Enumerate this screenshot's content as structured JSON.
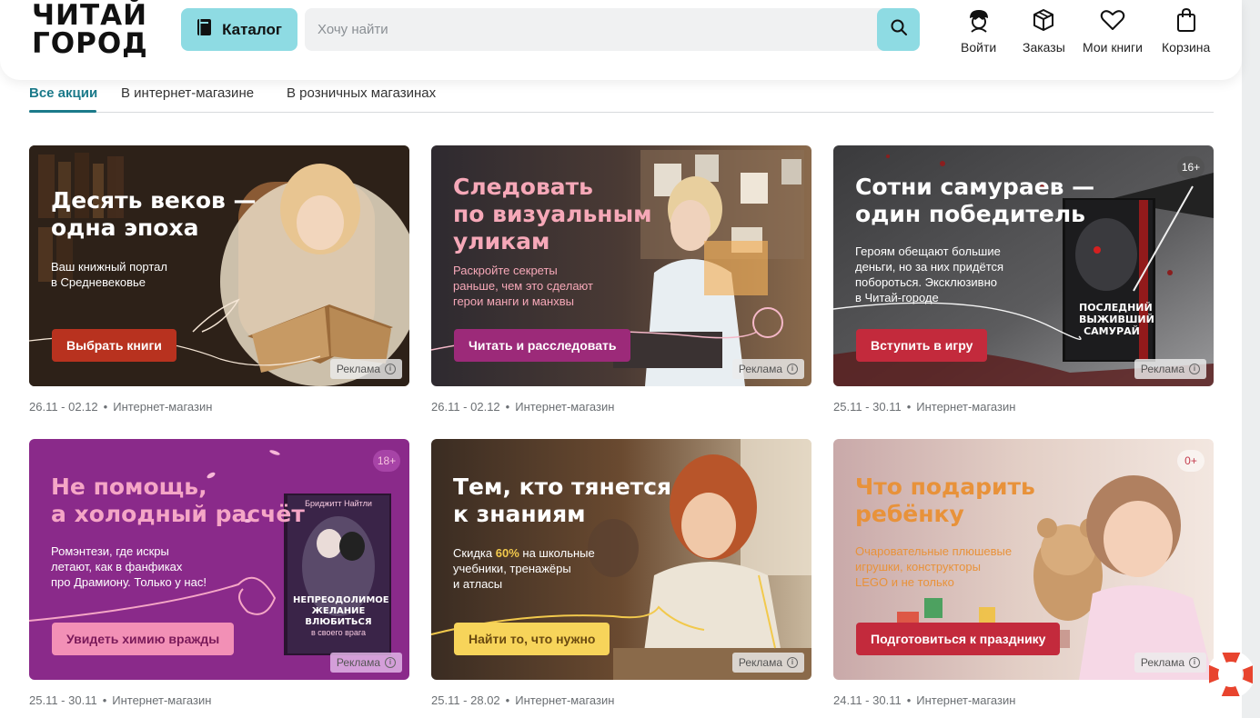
{
  "header": {
    "logo_line1": "ЧИТАЙ",
    "logo_line2": "ГОРОД",
    "catalog_label": "Каталог",
    "search_placeholder": "Хочу найти",
    "nav": [
      {
        "label": "Войти",
        "icon": "user-icon"
      },
      {
        "label": "Заказы",
        "icon": "box-icon"
      },
      {
        "label": "Мои книги",
        "icon": "heart-icon"
      },
      {
        "label": "Корзина",
        "icon": "bag-icon"
      }
    ]
  },
  "tabs": [
    {
      "label": "Все акции",
      "active": true
    },
    {
      "label": "В интернет-магазине",
      "active": false
    },
    {
      "label": "В розничных магазинах",
      "active": false
    }
  ],
  "colors": {
    "accent": "#8edbe3",
    "active_tab": "#1b7a8a"
  },
  "cards": [
    {
      "title_line1": "Десять веков —",
      "title_line2": "одна эпоха",
      "title_line3": "",
      "sub_line1": "Ваш книжный портал",
      "sub_line2": "в Средневековье",
      "sub_line3": "",
      "sub_line4": "",
      "cta": "Выбрать книги",
      "ad": "Реклама",
      "age": "",
      "dates": "26.11 - 02.12",
      "channel": "Интернет-магазин"
    },
    {
      "title_line1": "Следовать",
      "title_line2": "по визуальным",
      "title_line3": "уликам",
      "sub_line1": "Раскройте секреты",
      "sub_line2": "раньше, чем это сделают",
      "sub_line3": "герои манги и манхвы",
      "sub_line4": "",
      "cta": "Читать и расследовать",
      "ad": "Реклама",
      "age": "",
      "dates": "26.11 - 02.12",
      "channel": "Интернет-магазин"
    },
    {
      "title_line1": "Сотни самураев —",
      "title_line2": "один победитель",
      "title_line3": "",
      "sub_line1": "Героям обещают большие",
      "sub_line2": "деньги, но за них придётся",
      "sub_line3": "побороться. Эксклюзивно",
      "sub_line4": "в Читай-городе",
      "cta": "Вступить в игру",
      "ad": "Реклама",
      "age": "16+",
      "book_title": "ПОСЛЕДНИЙ ВЫЖИВШИЙ САМУРАЙ",
      "dates": "25.11 - 30.11",
      "channel": "Интернет-магазин"
    },
    {
      "title_line1": "Не помощь,",
      "title_line2": "а холодный расчёт",
      "title_line3": "",
      "sub_line1": "Ромэнтези, где искры",
      "sub_line2": "летают, как в фанфиках",
      "sub_line3": "про Драмиону. Только у нас!",
      "sub_line4": "",
      "cta": "Увидеть химию вражды",
      "ad": "Реклама",
      "age": "18+",
      "book_author": "Бриджитт Найтли",
      "book_title": "НЕПРЕОДОЛИМОЕ ЖЕЛАНИЕ ВЛЮБИТЬСЯ",
      "book_subtitle": "в своего врага",
      "dates": "25.11 - 30.11",
      "channel": "Интернет-магазин"
    },
    {
      "title_line1": "Тем, кто тянется",
      "title_line2": "к знаниям",
      "title_line3": "",
      "sub_line1_pre": "Скидка ",
      "sub_line1_em": "60%",
      "sub_line1_post": " на школьные",
      "sub_line2": "учебники, тренажёры",
      "sub_line3": "и атласы",
      "sub_line4": "",
      "cta": "Найти то, что нужно",
      "ad": "Реклама",
      "age": "",
      "dates": "25.11 - 28.02",
      "channel": "Интернет-магазин"
    },
    {
      "title_line1": "Что подарить",
      "title_line2": "ребёнку",
      "title_line3": "",
      "sub_line1": "Очаровательные плюшевые",
      "sub_line2": "игрушки, конструкторы",
      "sub_line3": "LEGO и не только",
      "sub_line4": "",
      "cta": "Подготовиться к празднику",
      "ad": "Реклама",
      "age": "0+",
      "dates": "24.11 - 30.11",
      "channel": "Интернет-магазин"
    }
  ]
}
